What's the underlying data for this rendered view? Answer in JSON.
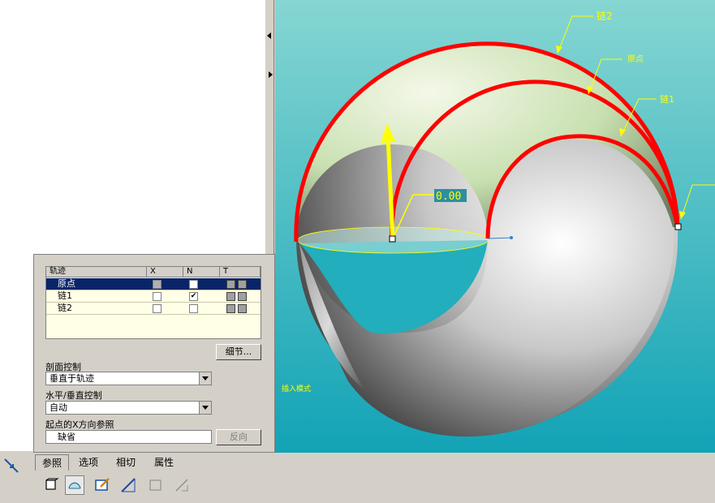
{
  "viewport": {
    "labels": {
      "chain2": "链2",
      "origin": "原点",
      "chain1": "链1",
      "dim_value": "0.00",
      "mode_text": "插入模式"
    },
    "colors": {
      "background_top": "#7fd3cf",
      "background_bottom": "#17a8b8",
      "trajectory": "#ff0000",
      "annotation": "#ffff00"
    }
  },
  "dashboard": {
    "table": {
      "headers": [
        "轨迹",
        "X",
        "N",
        "T"
      ],
      "rows": [
        {
          "name": "原点",
          "x": "",
          "n": "",
          "selected": true
        },
        {
          "name": "链1",
          "x": "",
          "n": "✔",
          "selected": false
        },
        {
          "name": "链2",
          "x": "",
          "n": "",
          "selected": false
        }
      ]
    },
    "details_button": "细节...",
    "section_control_label": "剖面控制",
    "section_control_value": "垂直于轨迹",
    "hv_control_label": "水平/垂直控制",
    "hv_control_value": "自动",
    "x_ref_label": "起点的X方向参照",
    "x_ref_value": "缺省",
    "flip_button": "反向"
  },
  "tabs": [
    "参照",
    "选项",
    "相切",
    "属性"
  ],
  "toolbar_icons": [
    "solid-icon",
    "surface-icon",
    "sketch-icon",
    "remove-material-icon",
    "thicken-icon",
    "trim-icon"
  ]
}
